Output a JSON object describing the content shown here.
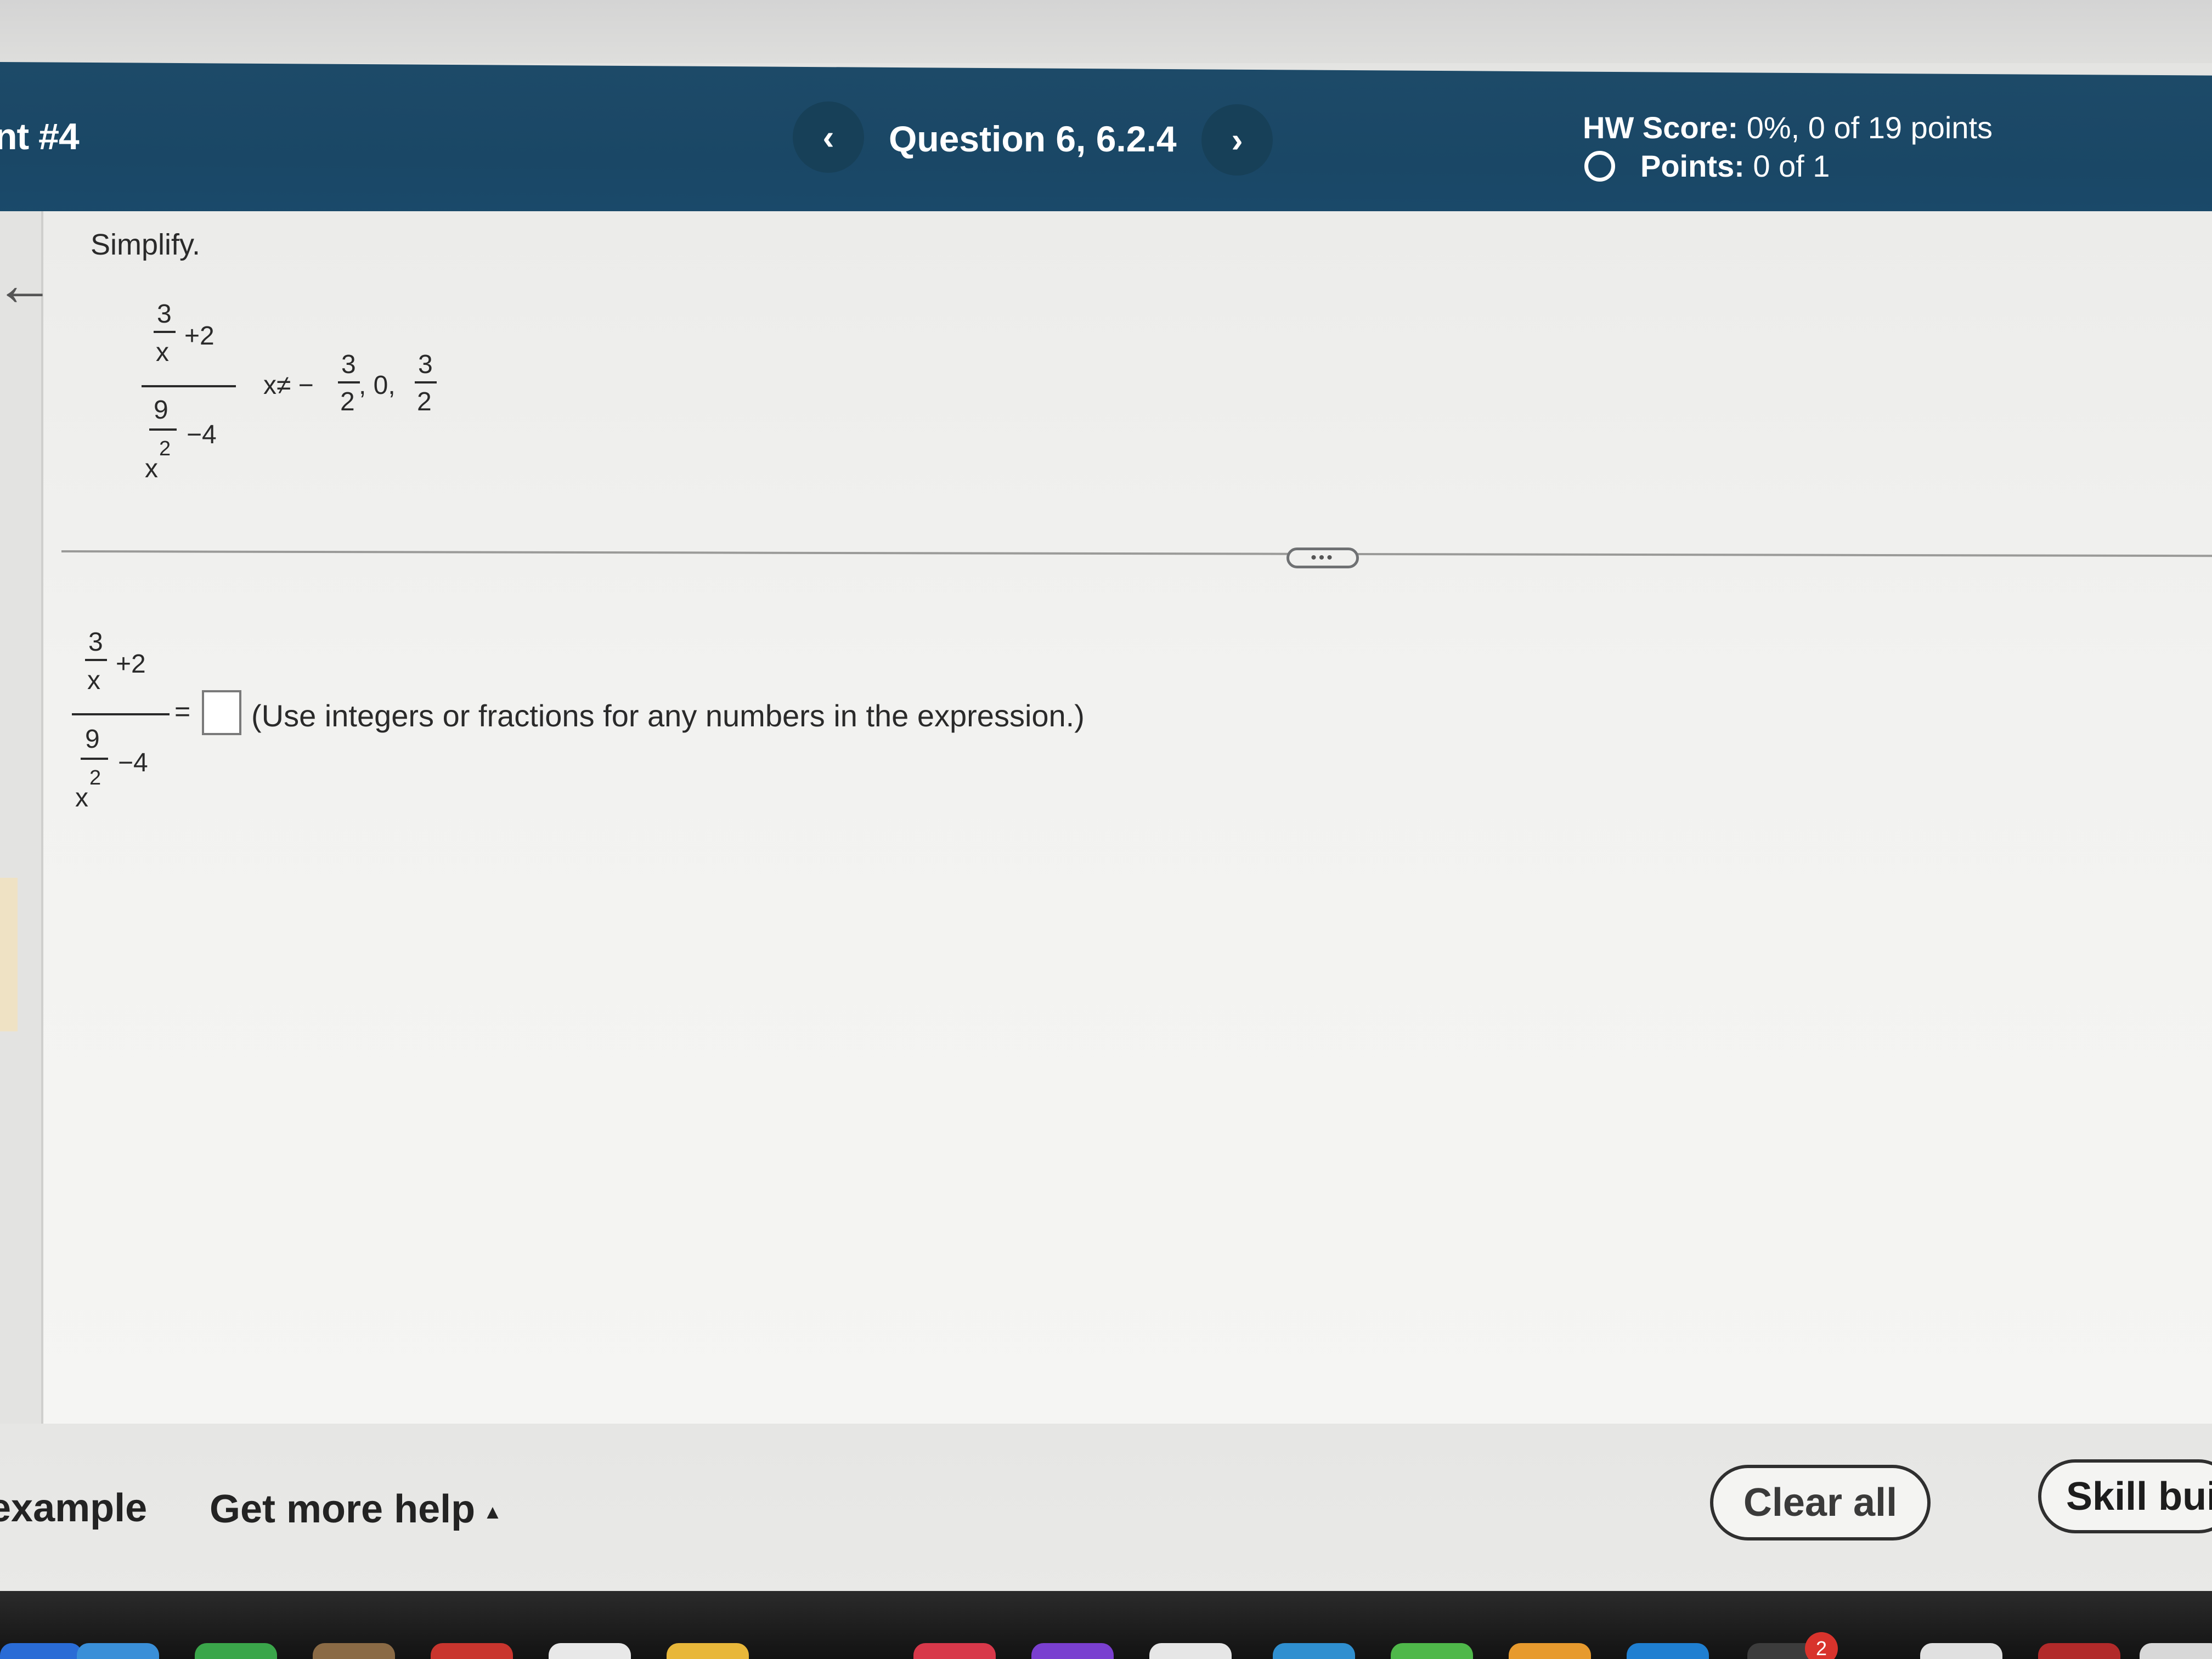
{
  "header": {
    "assignment_title": "nt #4",
    "prev_icon": "‹",
    "next_icon": "›",
    "question_title": "Question 6, 6.2.4",
    "hw_score_label": "HW Score:",
    "hw_score_value": "0%, 0 of 19 points",
    "points_label": "Points:",
    "points_value": "0 of 1"
  },
  "question": {
    "instruction": "Simplify.",
    "expr_num_frac_num": "3",
    "expr_num_frac_den": "x",
    "expr_num_plus": "+2",
    "expr_den_frac_num": "9",
    "expr_den_frac_den": "x",
    "expr_den_exp": "2",
    "expr_den_minus": "−4",
    "restriction_prefix": "x≠ −",
    "restriction_frac1_num": "3",
    "restriction_frac1_den": "2",
    "restriction_mid": ", 0,",
    "restriction_frac2_num": "3",
    "restriction_frac2_den": "2"
  },
  "divider": {
    "handle_text": "•••"
  },
  "answer": {
    "equals": "=",
    "hint": "(Use integers or fractions for any numbers in the expression.)"
  },
  "footer": {
    "view_example": "example",
    "get_more_help": "Get more help",
    "help_caret": "▲",
    "clear_all": "Clear all",
    "skill_builder": "Skill buil"
  },
  "dock": {
    "badge_count": "2"
  },
  "colors": {
    "header_bg": "#1a4766",
    "header_text": "#ffffff",
    "page_bg": "#f2f2f0",
    "text": "#2a2a2a"
  }
}
